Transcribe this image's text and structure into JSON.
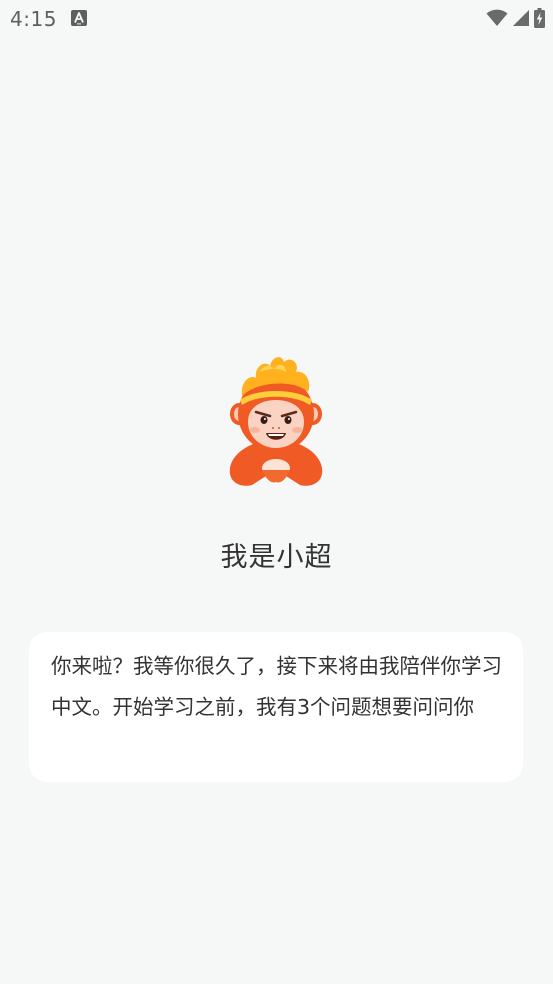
{
  "status_bar": {
    "time": "4:15",
    "notification_icon": "font-a-icon",
    "wifi_icon": "wifi-icon",
    "signal_icon": "cellular-signal-icon",
    "battery_icon": "battery-charging-icon"
  },
  "mascot": {
    "icon": "monkey-mascot-icon",
    "name": "我是小超"
  },
  "message": {
    "text": "你来啦？我等你很久了，接下来将由我陪伴你学习中文。开始学习之前，我有3个问题想要问问你"
  },
  "colors": {
    "background": "#f6f7f7",
    "card": "#ffffff",
    "text": "#333333",
    "mascot_primary": "#f05a24",
    "mascot_hair": "#ffb21e"
  }
}
